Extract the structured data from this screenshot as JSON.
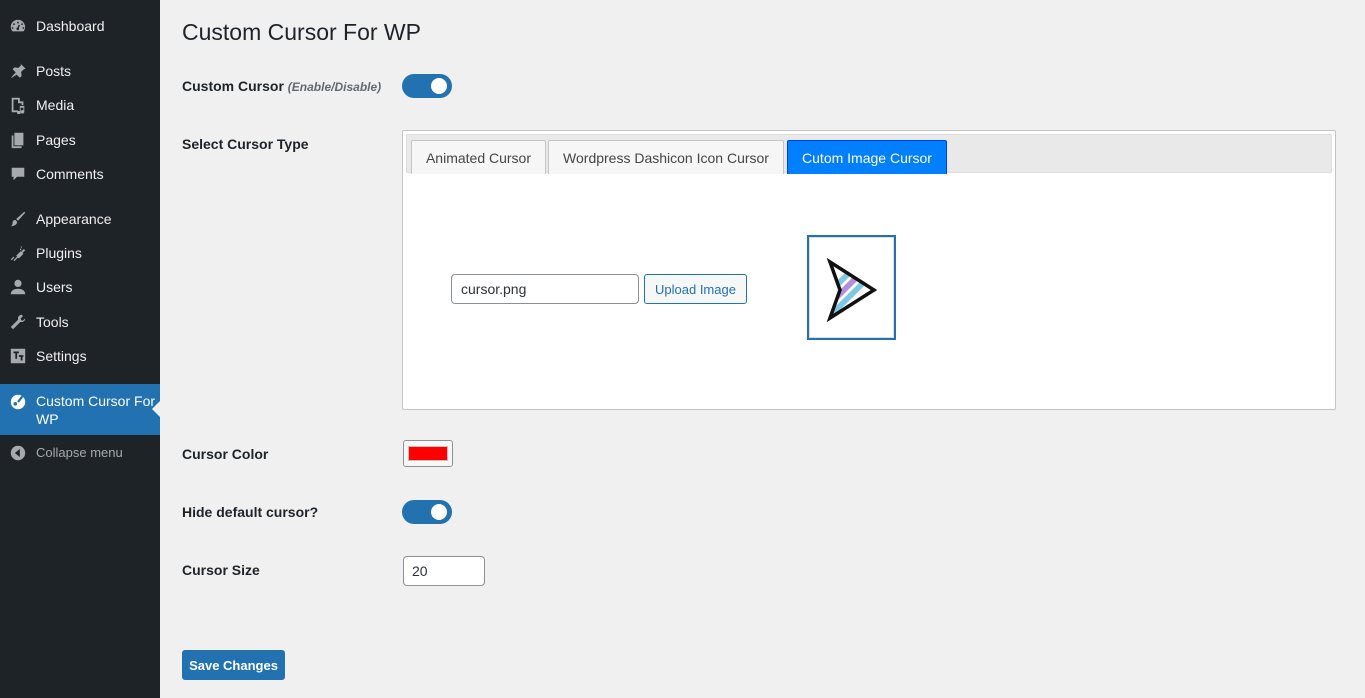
{
  "sidebar": {
    "items": [
      {
        "label": "Dashboard",
        "icon": "dashboard-icon"
      },
      {
        "label": "Posts",
        "icon": "pushpin-icon"
      },
      {
        "label": "Media",
        "icon": "media-icon"
      },
      {
        "label": "Pages",
        "icon": "pages-icon"
      },
      {
        "label": "Comments",
        "icon": "comments-icon"
      },
      {
        "label": "Appearance",
        "icon": "paintbrush-icon"
      },
      {
        "label": "Plugins",
        "icon": "plugins-icon"
      },
      {
        "label": "Users",
        "icon": "users-icon"
      },
      {
        "label": "Tools",
        "icon": "wrench-icon"
      },
      {
        "label": "Settings",
        "icon": "settings-icon"
      },
      {
        "label": "Custom Cursor For WP",
        "icon": "cursor-plugin-icon",
        "current": true
      }
    ],
    "collapse_label": "Collapse menu"
  },
  "page": {
    "title": "Custom Cursor For WP"
  },
  "settings": {
    "custom_cursor_label": "Custom Cursor",
    "custom_cursor_hint": "(Enable/Disable)",
    "custom_cursor_enabled": true,
    "cursor_type_label": "Select Cursor Type",
    "tabs": [
      {
        "label": "Animated Cursor",
        "active": false
      },
      {
        "label": "Wordpress Dashicon Icon Cursor",
        "active": false
      },
      {
        "label": "Cutom Image Cursor",
        "active": true
      }
    ],
    "image_file_value": "cursor.png",
    "upload_button_label": "Upload Image",
    "cursor_color_label": "Cursor Color",
    "cursor_color_value": "#ff0000",
    "hide_default_label": "Hide default cursor?",
    "hide_default_enabled": true,
    "cursor_size_label": "Cursor Size",
    "cursor_size_value": "20",
    "save_button_label": "Save Changes"
  },
  "colors": {
    "sidebar_bg": "#1d2327",
    "accent": "#2271b1",
    "active_tab": "#007fff",
    "page_bg": "#f0f0f1"
  }
}
